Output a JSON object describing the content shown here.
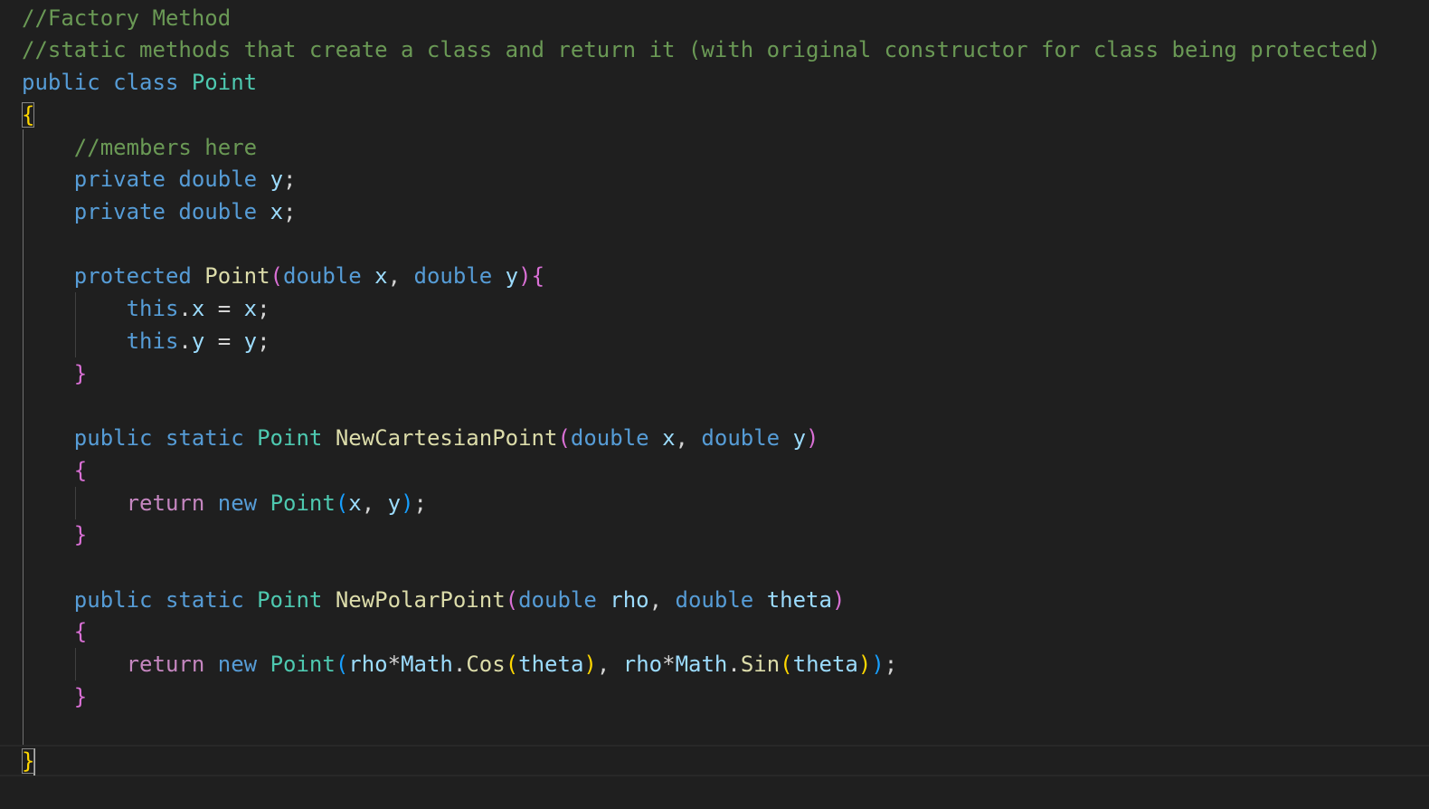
{
  "theme": {
    "background": "#1f1f1f",
    "comment": "#6a9955",
    "keyword": "#569cd6",
    "control": "#c586c0",
    "type": "#4ec9b0",
    "function": "#dcdcaa",
    "variable": "#9cdcfe",
    "plain": "#d4d4d4",
    "bracket_gold": "#ffd700",
    "bracket_pink": "#da70d6",
    "bracket_blue": "#179fff"
  },
  "lines": [
    [
      {
        "t": "//Factory Method",
        "c": "comment"
      }
    ],
    [
      {
        "t": "//static methods that create a class and return it (with original constructor for class being protected)",
        "c": "comment"
      }
    ],
    [
      {
        "t": "public",
        "c": "keyword"
      },
      {
        "t": " ",
        "c": "plain"
      },
      {
        "t": "class",
        "c": "keyword"
      },
      {
        "t": " ",
        "c": "plain"
      },
      {
        "t": "Point",
        "c": "type"
      }
    ],
    [
      {
        "t": "{",
        "c": "bracket_gold",
        "box": true
      }
    ],
    [
      {
        "t": "    ",
        "c": "plain"
      },
      {
        "t": "//members here",
        "c": "comment"
      }
    ],
    [
      {
        "t": "    ",
        "c": "plain"
      },
      {
        "t": "private",
        "c": "keyword"
      },
      {
        "t": " ",
        "c": "plain"
      },
      {
        "t": "double",
        "c": "keyword"
      },
      {
        "t": " ",
        "c": "plain"
      },
      {
        "t": "y",
        "c": "variable"
      },
      {
        "t": ";",
        "c": "plain"
      }
    ],
    [
      {
        "t": "    ",
        "c": "plain"
      },
      {
        "t": "private",
        "c": "keyword"
      },
      {
        "t": " ",
        "c": "plain"
      },
      {
        "t": "double",
        "c": "keyword"
      },
      {
        "t": " ",
        "c": "plain"
      },
      {
        "t": "x",
        "c": "variable"
      },
      {
        "t": ";",
        "c": "plain"
      }
    ],
    [],
    [
      {
        "t": "    ",
        "c": "plain"
      },
      {
        "t": "protected",
        "c": "keyword"
      },
      {
        "t": " ",
        "c": "plain"
      },
      {
        "t": "Point",
        "c": "function"
      },
      {
        "t": "(",
        "c": "bracket_pink"
      },
      {
        "t": "double",
        "c": "keyword"
      },
      {
        "t": " ",
        "c": "plain"
      },
      {
        "t": "x",
        "c": "variable"
      },
      {
        "t": ", ",
        "c": "plain"
      },
      {
        "t": "double",
        "c": "keyword"
      },
      {
        "t": " ",
        "c": "plain"
      },
      {
        "t": "y",
        "c": "variable"
      },
      {
        "t": "){",
        "c": "bracket_pink"
      }
    ],
    [
      {
        "t": "        ",
        "c": "plain"
      },
      {
        "t": "this",
        "c": "keyword"
      },
      {
        "t": ".",
        "c": "plain"
      },
      {
        "t": "x",
        "c": "variable"
      },
      {
        "t": " = ",
        "c": "plain"
      },
      {
        "t": "x",
        "c": "variable"
      },
      {
        "t": ";",
        "c": "plain"
      }
    ],
    [
      {
        "t": "        ",
        "c": "plain"
      },
      {
        "t": "this",
        "c": "keyword"
      },
      {
        "t": ".",
        "c": "plain"
      },
      {
        "t": "y",
        "c": "variable"
      },
      {
        "t": " = ",
        "c": "plain"
      },
      {
        "t": "y",
        "c": "variable"
      },
      {
        "t": ";",
        "c": "plain"
      }
    ],
    [
      {
        "t": "    ",
        "c": "plain"
      },
      {
        "t": "}",
        "c": "bracket_pink"
      }
    ],
    [],
    [
      {
        "t": "    ",
        "c": "plain"
      },
      {
        "t": "public",
        "c": "keyword"
      },
      {
        "t": " ",
        "c": "plain"
      },
      {
        "t": "static",
        "c": "keyword"
      },
      {
        "t": " ",
        "c": "plain"
      },
      {
        "t": "Point",
        "c": "type"
      },
      {
        "t": " ",
        "c": "plain"
      },
      {
        "t": "NewCartesianPoint",
        "c": "function"
      },
      {
        "t": "(",
        "c": "bracket_pink"
      },
      {
        "t": "double",
        "c": "keyword"
      },
      {
        "t": " ",
        "c": "plain"
      },
      {
        "t": "x",
        "c": "variable"
      },
      {
        "t": ", ",
        "c": "plain"
      },
      {
        "t": "double",
        "c": "keyword"
      },
      {
        "t": " ",
        "c": "plain"
      },
      {
        "t": "y",
        "c": "variable"
      },
      {
        "t": ")",
        "c": "bracket_pink"
      }
    ],
    [
      {
        "t": "    ",
        "c": "plain"
      },
      {
        "t": "{",
        "c": "bracket_pink"
      }
    ],
    [
      {
        "t": "        ",
        "c": "plain"
      },
      {
        "t": "return",
        "c": "control"
      },
      {
        "t": " ",
        "c": "plain"
      },
      {
        "t": "new",
        "c": "keyword"
      },
      {
        "t": " ",
        "c": "plain"
      },
      {
        "t": "Point",
        "c": "type"
      },
      {
        "t": "(",
        "c": "bracket_blue"
      },
      {
        "t": "x",
        "c": "variable"
      },
      {
        "t": ", ",
        "c": "plain"
      },
      {
        "t": "y",
        "c": "variable"
      },
      {
        "t": ")",
        "c": "bracket_blue"
      },
      {
        "t": ";",
        "c": "plain"
      }
    ],
    [
      {
        "t": "    ",
        "c": "plain"
      },
      {
        "t": "}",
        "c": "bracket_pink"
      }
    ],
    [],
    [
      {
        "t": "    ",
        "c": "plain"
      },
      {
        "t": "public",
        "c": "keyword"
      },
      {
        "t": " ",
        "c": "plain"
      },
      {
        "t": "static",
        "c": "keyword"
      },
      {
        "t": " ",
        "c": "plain"
      },
      {
        "t": "Point",
        "c": "type"
      },
      {
        "t": " ",
        "c": "plain"
      },
      {
        "t": "NewPolarPoint",
        "c": "function"
      },
      {
        "t": "(",
        "c": "bracket_pink"
      },
      {
        "t": "double",
        "c": "keyword"
      },
      {
        "t": " ",
        "c": "plain"
      },
      {
        "t": "rho",
        "c": "variable"
      },
      {
        "t": ", ",
        "c": "plain"
      },
      {
        "t": "double",
        "c": "keyword"
      },
      {
        "t": " ",
        "c": "plain"
      },
      {
        "t": "theta",
        "c": "variable"
      },
      {
        "t": ")",
        "c": "bracket_pink"
      }
    ],
    [
      {
        "t": "    ",
        "c": "plain"
      },
      {
        "t": "{",
        "c": "bracket_pink"
      }
    ],
    [
      {
        "t": "        ",
        "c": "plain"
      },
      {
        "t": "return",
        "c": "control"
      },
      {
        "t": " ",
        "c": "plain"
      },
      {
        "t": "new",
        "c": "keyword"
      },
      {
        "t": " ",
        "c": "plain"
      },
      {
        "t": "Point",
        "c": "type"
      },
      {
        "t": "(",
        "c": "bracket_blue"
      },
      {
        "t": "rho",
        "c": "variable"
      },
      {
        "t": "*",
        "c": "plain"
      },
      {
        "t": "Math",
        "c": "variable"
      },
      {
        "t": ".",
        "c": "plain"
      },
      {
        "t": "Cos",
        "c": "function"
      },
      {
        "t": "(",
        "c": "bracket_gold"
      },
      {
        "t": "theta",
        "c": "variable"
      },
      {
        "t": ")",
        "c": "bracket_gold"
      },
      {
        "t": ", ",
        "c": "plain"
      },
      {
        "t": "rho",
        "c": "variable"
      },
      {
        "t": "*",
        "c": "plain"
      },
      {
        "t": "Math",
        "c": "variable"
      },
      {
        "t": ".",
        "c": "plain"
      },
      {
        "t": "Sin",
        "c": "function"
      },
      {
        "t": "(",
        "c": "bracket_gold"
      },
      {
        "t": "theta",
        "c": "variable"
      },
      {
        "t": ")",
        "c": "bracket_gold"
      },
      {
        "t": ")",
        "c": "bracket_blue"
      },
      {
        "t": ";",
        "c": "plain"
      }
    ],
    [
      {
        "t": "    ",
        "c": "plain"
      },
      {
        "t": "}",
        "c": "bracket_pink"
      }
    ],
    [],
    [
      {
        "t": "}",
        "c": "bracket_gold",
        "box": true,
        "cursor": true
      }
    ]
  ]
}
